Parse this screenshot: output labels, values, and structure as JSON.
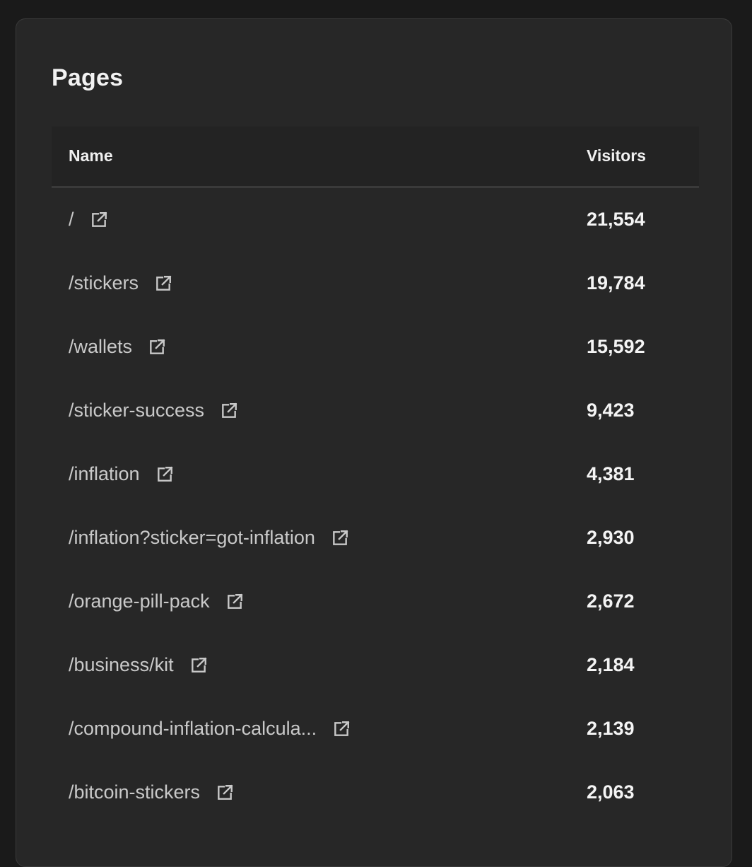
{
  "panel": {
    "title": "Pages"
  },
  "table": {
    "headers": {
      "name": "Name",
      "visitors": "Visitors"
    },
    "rows": [
      {
        "name": "/",
        "visitors": "21,554",
        "icon": "external-link-icon"
      },
      {
        "name": "/stickers",
        "visitors": "19,784",
        "icon": "external-link-icon"
      },
      {
        "name": "/wallets",
        "visitors": "15,592",
        "icon": "external-link-icon"
      },
      {
        "name": "/sticker-success",
        "visitors": "9,423",
        "icon": "external-link-icon"
      },
      {
        "name": "/inflation",
        "visitors": "4,381",
        "icon": "external-link-icon"
      },
      {
        "name": "/inflation?sticker=got-inflation",
        "visitors": "2,930",
        "icon": "external-link-icon"
      },
      {
        "name": "/orange-pill-pack",
        "visitors": "2,672",
        "icon": "external-link-icon"
      },
      {
        "name": "/business/kit",
        "visitors": "2,184",
        "icon": "external-link-icon"
      },
      {
        "name": "/compound-inflation-calcula...",
        "visitors": "2,139",
        "icon": "external-link-icon"
      },
      {
        "name": "/bitcoin-stickers",
        "visitors": "2,063",
        "icon": "external-link-icon"
      }
    ]
  },
  "colors": {
    "background": "#1a1a1a",
    "card": "#272727",
    "header_bg": "#232323",
    "divider": "#3a3a3a",
    "text_primary": "#f4f4f4",
    "text_secondary": "#c9c9c9"
  }
}
